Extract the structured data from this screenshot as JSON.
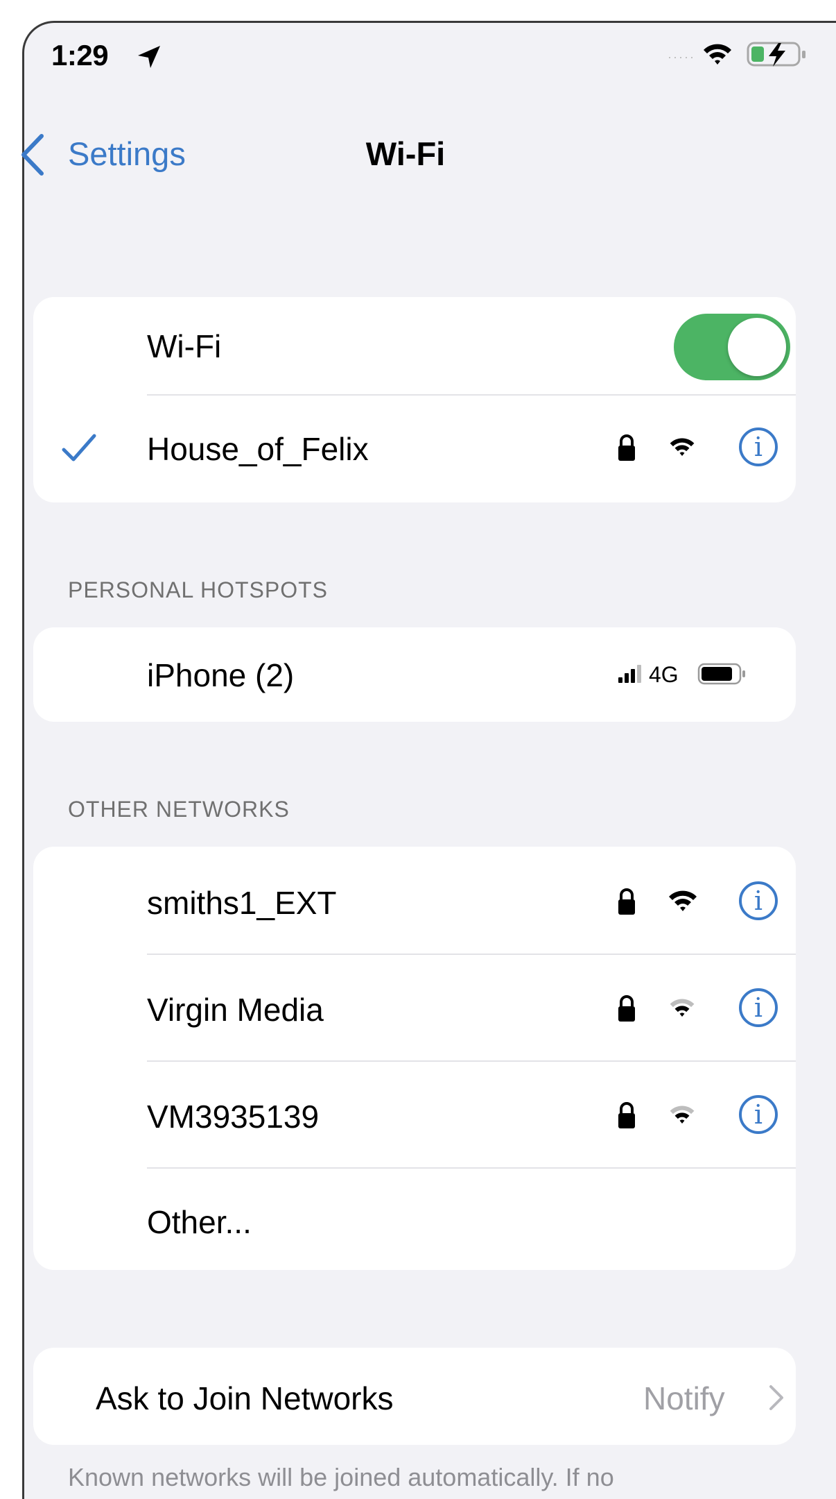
{
  "status_bar": {
    "time": "1:29",
    "location_icon": "location-arrow-icon",
    "signal_dots": "·····",
    "wifi_icon": "wifi-icon",
    "battery_icon": "battery-charging-icon"
  },
  "nav": {
    "back_label": "Settings",
    "title": "Wi-Fi"
  },
  "wifi_card": {
    "label": "Wi-Fi",
    "toggle_on": true,
    "connected_network": {
      "name": "House_of_Felix",
      "secured": true,
      "checkmark_icon": "checkmark-icon",
      "lock_icon": "lock-icon",
      "signal_icon": "wifi-signal-icon",
      "info_icon": "info-icon"
    }
  },
  "personal_hotspots": {
    "header": "PERSONAL HOTSPOTS",
    "items": [
      {
        "name": "iPhone (2)",
        "network_type": "4G",
        "signal_icon": "cellular-signal-icon",
        "battery_icon": "battery-icon"
      }
    ]
  },
  "other_networks": {
    "header": "OTHER NETWORKS",
    "items": [
      {
        "name": "smiths1_EXT",
        "secured": true
      },
      {
        "name": "Virgin Media",
        "secured": true
      },
      {
        "name": "VM3935139",
        "secured": true
      }
    ],
    "other_label": "Other..."
  },
  "ask_to_join": {
    "label": "Ask to Join Networks",
    "value": "Notify",
    "chevron_icon": "chevron-right-icon"
  },
  "footer_note": "Known networks will be joined automatically. If no",
  "colors": {
    "accent": "#3b7ac8",
    "toggle_on": "#4cb464",
    "background": "#f2f2f6"
  }
}
